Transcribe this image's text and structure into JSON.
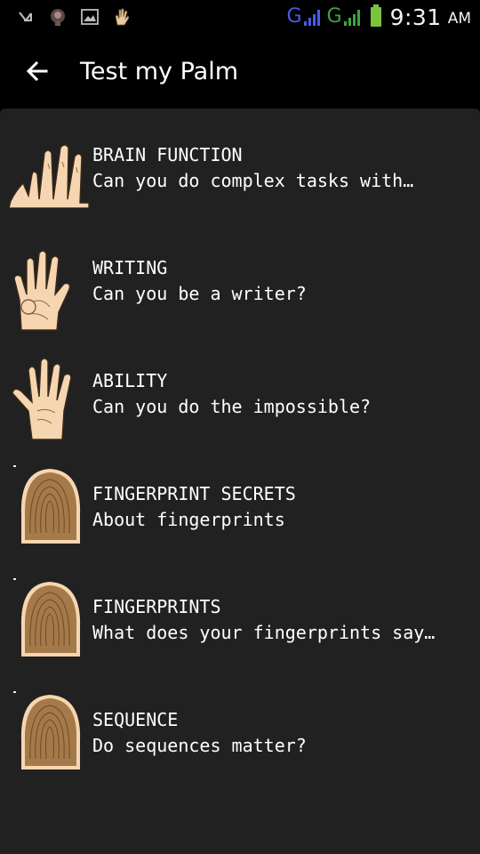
{
  "status_bar": {
    "network_1": "G",
    "network_2": "G",
    "time": "9:31",
    "ampm": "AM",
    "icons": [
      "signal-off-icon",
      "avatar-icon",
      "image-icon",
      "hand-icon"
    ]
  },
  "toolbar": {
    "back_icon": "arrow-left-icon",
    "title": "Test my Palm"
  },
  "items": [
    {
      "title": "BRAIN FUNCTION",
      "subtitle": "Can you do complex tasks with…",
      "icon": "palm-fingers-icon"
    },
    {
      "title": "WRITING",
      "subtitle": "Can you be a writer?",
      "icon": "palm-hand-icon"
    },
    {
      "title": "ABILITY",
      "subtitle": "Can you do the impossible?",
      "icon": "open-hand-icon"
    },
    {
      "title": "FINGERPRINT SECRETS",
      "subtitle": "About fingerprints",
      "icon": "fingerprint-icon"
    },
    {
      "title": "FINGERPRINTS",
      "subtitle": "What does your fingerprints say…",
      "icon": "fingerprint-icon"
    },
    {
      "title": "SEQUENCE",
      "subtitle": "Do sequences matter?",
      "icon": "fingerprint-icon"
    }
  ],
  "colors": {
    "background": "#212121",
    "toolbar": "#000000",
    "skin": "#f6d6b0",
    "fingerprint": "#a57a4a"
  }
}
